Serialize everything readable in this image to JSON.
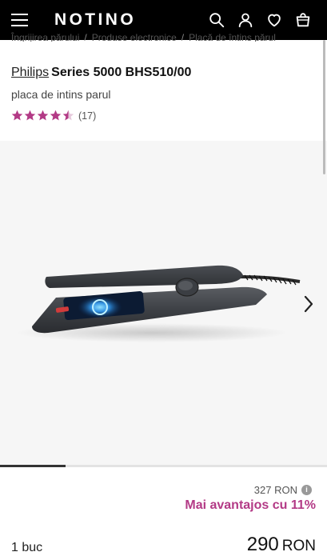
{
  "header": {
    "logo": "NOTINO",
    "icons": [
      "menu-icon",
      "search-icon",
      "account-icon",
      "heart-icon",
      "cart-icon"
    ]
  },
  "breadcrumb": [
    "Îngrijirea părului",
    "Produse electronice",
    "Placă de întins părul"
  ],
  "product": {
    "brand": "Philips",
    "model": "Series 5000 BHS510/00",
    "subtitle": "placa de intins parul",
    "rating": 4.5,
    "review_count": "(17)"
  },
  "gallery": {
    "image_description": "dark grey hair straightener with blue display",
    "current_position": 0.2
  },
  "pricing": {
    "old_price": "327 RON",
    "info_icon": "i",
    "discount_text": "Mai avantajos cu 11%",
    "quantity": "1 buc",
    "price_amount": "290",
    "currency": "RON"
  },
  "colors": {
    "header_bg": "#000000",
    "accent": "#b33a86",
    "star": "#b33a86"
  }
}
